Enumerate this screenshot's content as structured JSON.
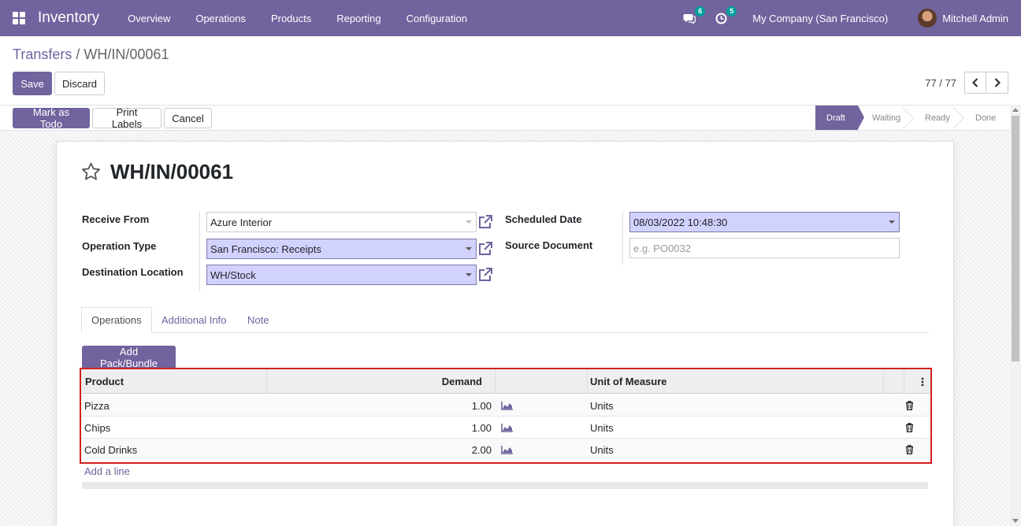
{
  "navbar": {
    "app_name": "Inventory",
    "menu": [
      "Overview",
      "Operations",
      "Products",
      "Reporting",
      "Configuration"
    ],
    "messages_badge": "6",
    "activities_badge": "5",
    "company": "My Company (San Francisco)",
    "user": "Mitchell Admin"
  },
  "breadcrumb": {
    "parent": "Transfers",
    "separator": "/",
    "current": "WH/IN/00061"
  },
  "actions": {
    "save": "Save",
    "discard": "Discard"
  },
  "pager": {
    "value": "77 / 77"
  },
  "statusbar": {
    "buttons": {
      "mark_todo": "Mark as Todo",
      "print_labels": "Print Labels",
      "cancel": "Cancel"
    },
    "stages": [
      "Draft",
      "Waiting",
      "Ready",
      "Done"
    ],
    "active_stage": "Draft"
  },
  "record": {
    "title": "WH/IN/00061",
    "left_fields": [
      {
        "label": "Receive From",
        "value": "Azure Interior",
        "required": false
      },
      {
        "label": "Operation Type",
        "value": "San Francisco: Receipts",
        "required": true
      },
      {
        "label": "Destination Location",
        "value": "WH/Stock",
        "required": true
      }
    ],
    "right_fields": [
      {
        "label": "Scheduled Date",
        "value": "08/03/2022 10:48:30",
        "required": true
      },
      {
        "label": "Source Document",
        "value": "",
        "placeholder": "e.g. PO0032"
      }
    ]
  },
  "tabs": [
    "Operations",
    "Additional Info",
    "Note"
  ],
  "active_tab": "Operations",
  "add_pack_label": "Add Pack/Bundle",
  "table": {
    "headers": {
      "product": "Product",
      "demand": "Demand",
      "uom": "Unit of Measure"
    },
    "rows": [
      {
        "product": "Pizza",
        "demand": "1.00",
        "uom": "Units"
      },
      {
        "product": "Chips",
        "demand": "1.00",
        "uom": "Units"
      },
      {
        "product": "Cold Drinks",
        "demand": "2.00",
        "uom": "Units"
      }
    ],
    "add_line": "Add a line"
  },
  "colors": {
    "brand": "#71639e",
    "required_field": "#d2d2ff",
    "highlight": "#d21f1f"
  }
}
